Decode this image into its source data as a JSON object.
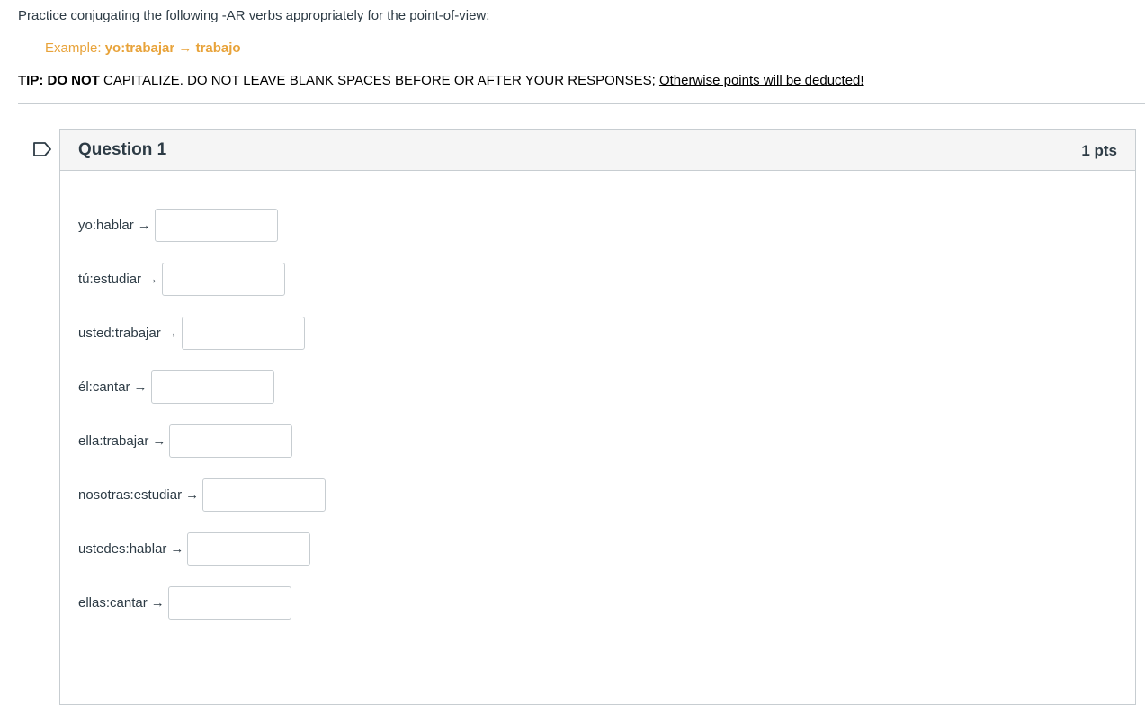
{
  "instructions": {
    "intro": "Practice conjugating the following -AR verbs appropriately for the point-of-view:",
    "example_prefix": "Example: ",
    "example_prompt": "yo:trabajar",
    "example_arrow": " → ",
    "example_answer": "trabajo",
    "tip_bold": "TIP: DO NOT",
    "tip_caps": " CAPITALIZE. DO NOT LEAVE BLANK SPACES BEFORE OR AFTER YOUR RESPONSES;",
    "tip_link": "Otherwise points will be deducted!"
  },
  "question": {
    "title": "Question 1",
    "points": "1 pts",
    "arrow": "→",
    "items": [
      {
        "prompt": "yo:hablar",
        "value": ""
      },
      {
        "prompt": "tú:estudiar",
        "value": ""
      },
      {
        "prompt": "usted:trabajar",
        "value": ""
      },
      {
        "prompt": "él:cantar",
        "value": ""
      },
      {
        "prompt": "ella:trabajar",
        "value": ""
      },
      {
        "prompt": "nosotras:estudiar",
        "value": ""
      },
      {
        "prompt": "ustedes:hablar",
        "value": ""
      },
      {
        "prompt": "ellas:cantar",
        "value": ""
      }
    ]
  },
  "icons": {
    "flag": "flag-icon"
  }
}
